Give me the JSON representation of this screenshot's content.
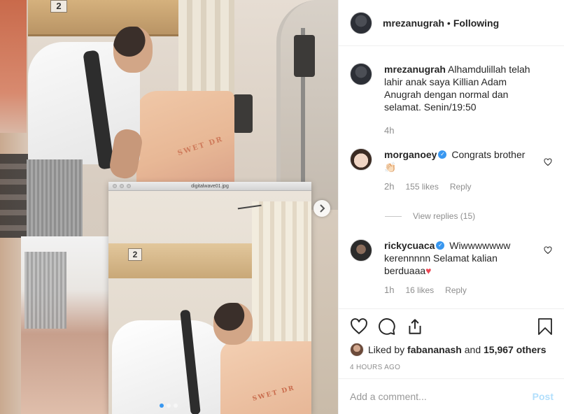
{
  "media": {
    "inner_window_title": "digitalwave01.jpg",
    "cabinet_number": "2",
    "blanket_print": "SWET DR",
    "carousel": {
      "count": 3,
      "active_index": 0
    }
  },
  "header": {
    "username": "mrezanugrah",
    "separator": "•",
    "follow_status": "Following"
  },
  "caption": {
    "username": "mrezanugrah",
    "text": "Alhamdulillah telah lahir anak saya Killian Adam Anugrah dengan normal dan selamat. Senin/19:50",
    "time": "4h"
  },
  "comments": [
    {
      "username": "morganoey",
      "verified": true,
      "text": "Congrats brother",
      "emoji": "👏🏻",
      "time": "2h",
      "likes": "155 likes",
      "reply_label": "Reply"
    },
    {
      "username": "rickycuaca",
      "verified": true,
      "text": "Wiwwwwwww kerennnnn Selamat kalian berduaaa",
      "emoji": "♥",
      "time": "1h",
      "likes": "16 likes",
      "reply_label": "Reply"
    }
  ],
  "view_replies": "View replies (15)",
  "actions": {
    "icons": [
      "heart-icon",
      "comment-icon",
      "share-icon",
      "bookmark-icon"
    ]
  },
  "likes": {
    "prefix": "Liked by",
    "user": "fabananash",
    "middle": "and",
    "others": "15,967 others"
  },
  "posted_ago": "4 HOURS AGO",
  "add_comment": {
    "placeholder": "Add a comment...",
    "post_label": "Post"
  },
  "colors": {
    "verified": "#3897f0",
    "heart_red": "#ed4956",
    "post_disabled": "#b2dffc",
    "muted_text": "#8e8e8e"
  }
}
